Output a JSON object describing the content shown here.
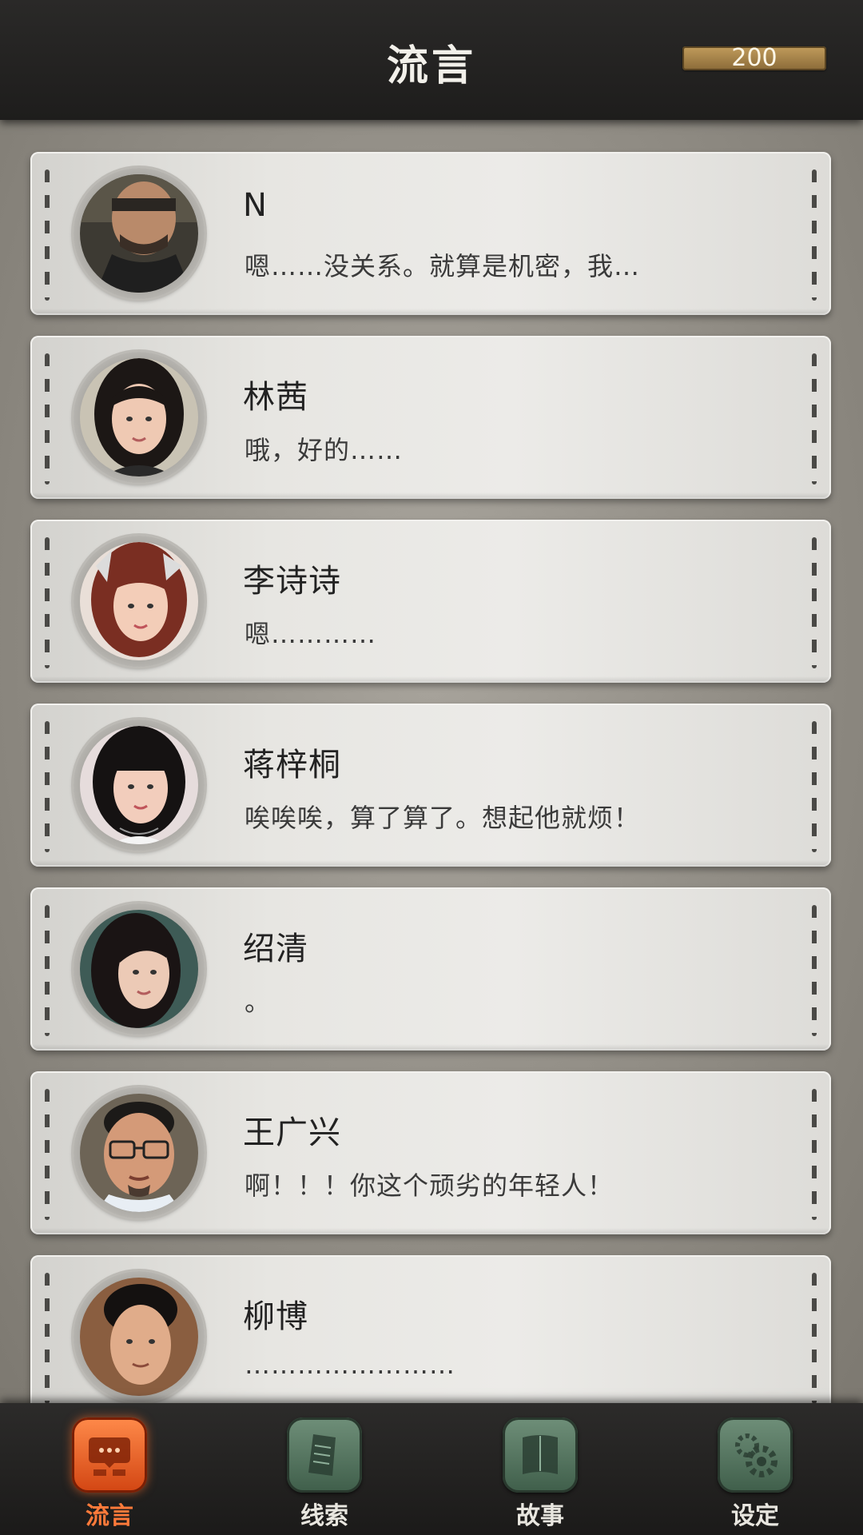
{
  "header": {
    "title": "流言",
    "coins": "200"
  },
  "rumors": [
    {
      "name": "N",
      "message": "嗯……没关系。就算是机密，我…",
      "avatar": "avatar-man-glasses-dark"
    },
    {
      "name": "林茜",
      "message": "哦，好的……",
      "avatar": "avatar-woman-black-hair"
    },
    {
      "name": "李诗诗",
      "message": "嗯…………",
      "avatar": "avatar-woman-red-hair"
    },
    {
      "name": "蒋梓桐",
      "message": "唉唉唉，算了算了。想起他就烦！",
      "avatar": "avatar-woman-bangs"
    },
    {
      "name": "绍清",
      "message": "。",
      "avatar": "avatar-woman-long-hair"
    },
    {
      "name": "王广兴",
      "message": "啊！！！你这个顽劣的年轻人！",
      "avatar": "avatar-man-glasses"
    },
    {
      "name": "柳博",
      "message": "……………………",
      "avatar": "avatar-man-short-hair"
    }
  ],
  "nav": [
    {
      "label": "流言",
      "icon": "chat-bubble-icon",
      "active": true
    },
    {
      "label": "线索",
      "icon": "document-icon",
      "active": false
    },
    {
      "label": "故事",
      "icon": "book-icon",
      "active": false
    },
    {
      "label": "设定",
      "icon": "gear-icon",
      "active": false
    }
  ],
  "colors": {
    "accent": "#ff7a3a",
    "nav_icon": "#4f6e59",
    "coin_bar": "#a9854a"
  }
}
